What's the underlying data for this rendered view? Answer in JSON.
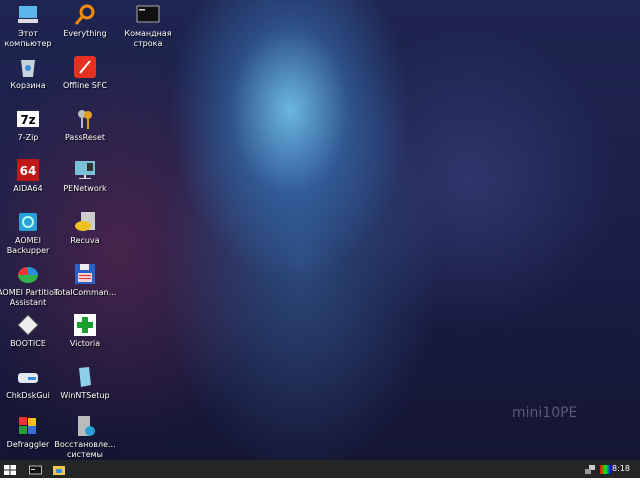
{
  "desktop": {
    "icons": [
      {
        "label": "Этот\nкомпьютер",
        "icon": "computer-icon"
      },
      {
        "label": "Корзина",
        "icon": "recycle-bin-icon"
      },
      {
        "label": "7-Zip",
        "icon": "7zip-icon"
      },
      {
        "label": "AIDA64",
        "icon": "aida64-icon",
        "glyph": "64"
      },
      {
        "label": "AOMEI\nBackupper",
        "icon": "aomei-backupper-icon"
      },
      {
        "label": "AOMEI Partition\nAssistant",
        "icon": "aomei-partition-icon"
      },
      {
        "label": "BOOTICE",
        "icon": "bootice-icon"
      },
      {
        "label": "ChkDskGui",
        "icon": "drive-icon"
      },
      {
        "label": "Defraggler",
        "icon": "defraggler-icon"
      },
      {
        "label": "Everything",
        "icon": "search-icon"
      },
      {
        "label": "Offline SFC",
        "icon": "offline-sfc-icon"
      },
      {
        "label": "PassReset",
        "icon": "keys-icon"
      },
      {
        "label": "PENetwork",
        "icon": "network-icon"
      },
      {
        "label": "Recuva",
        "icon": "recuva-icon"
      },
      {
        "label": "TotalComman...",
        "icon": "floppy-icon"
      },
      {
        "label": "Victoria",
        "icon": "victoria-icon"
      },
      {
        "label": "WinNTSetup",
        "icon": "winntsetup-icon"
      },
      {
        "label": "Восстановле...\nсистемы",
        "icon": "system-restore-icon"
      },
      {
        "label": "Командная\nстрока",
        "icon": "cmd-icon"
      }
    ],
    "watermark": "mini10PE"
  },
  "taskbar": {
    "clock": "8:18"
  }
}
